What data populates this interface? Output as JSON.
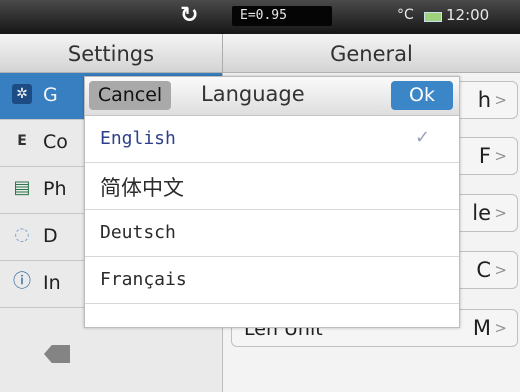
{
  "statusbar": {
    "refresh_icon": "↻",
    "emissivity": "E=0.95",
    "unit": "°C",
    "time": "12:00"
  },
  "header": {
    "left_title": "Settings",
    "right_title": "General"
  },
  "sidebar": {
    "items": [
      {
        "label": "G",
        "icon": "gear-icon",
        "glyph": "✲",
        "selected": true
      },
      {
        "label": "Co",
        "icon": "image-compare-icon",
        "glyph": "E",
        "selected": false
      },
      {
        "label": "Ph",
        "icon": "photo-icon",
        "glyph": "▤",
        "selected": false
      },
      {
        "label": "D",
        "icon": "clock-icon",
        "glyph": "◌",
        "selected": false
      },
      {
        "label": "In",
        "icon": "info-icon",
        "glyph": "ⓘ",
        "selected": false
      }
    ]
  },
  "rows": [
    {
      "label": "",
      "value": "h"
    },
    {
      "label": "",
      "value": "F"
    },
    {
      "label": "",
      "value": "le"
    },
    {
      "label": "",
      "value": "C"
    },
    {
      "label": "Len Unit",
      "value": "M"
    }
  ],
  "dialog": {
    "cancel_label": "Cancel",
    "title": "Language",
    "ok_label": "Ok",
    "languages": [
      {
        "name": "English",
        "selected": true
      },
      {
        "name": "简体中文",
        "selected": false
      },
      {
        "name": "Deutsch",
        "selected": false
      },
      {
        "name": "Français",
        "selected": false
      }
    ],
    "check_mark": "✓"
  },
  "colors": {
    "accent": "#3b85c9",
    "statusbar": "#2a2a2a"
  }
}
